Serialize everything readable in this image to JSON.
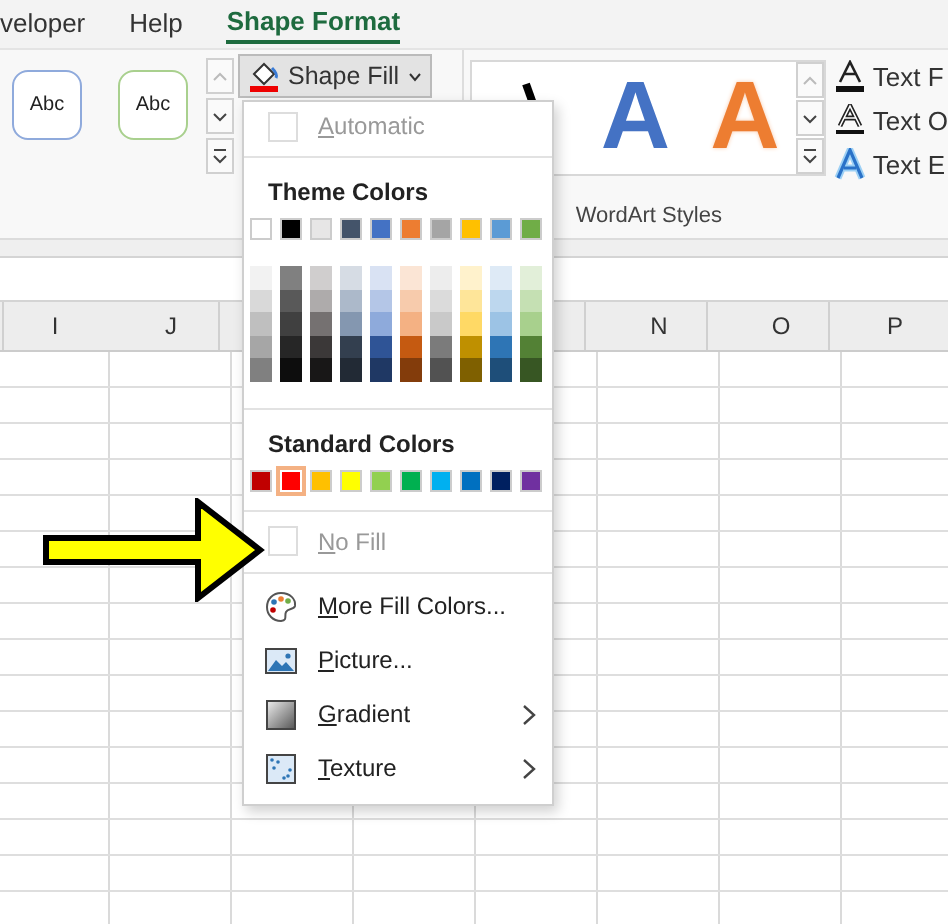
{
  "tabs": [
    {
      "label": "veloper",
      "selected": false
    },
    {
      "label": "Help",
      "selected": false
    },
    {
      "label": "Shape Format",
      "selected": true
    }
  ],
  "shape_styles": [
    {
      "label": "Abc",
      "color": "#8faadc"
    },
    {
      "label": "Abc",
      "color": "#a9d08e"
    }
  ],
  "shape_fill_button": {
    "label": "Shape Fill"
  },
  "wordart_styles": {
    "group_label": "WordArt Styles",
    "items": [
      {
        "letter": "A",
        "color": "#4472c4",
        "kind": "solid"
      },
      {
        "letter": "A",
        "color": "#ed7d31",
        "kind": "outline"
      }
    ]
  },
  "text_buttons": [
    {
      "label": "Text F",
      "kind": "fill"
    },
    {
      "label": "Text O",
      "kind": "outline"
    },
    {
      "label": "Text E",
      "kind": "effects"
    }
  ],
  "grid": {
    "columns_left_of_menu": [
      "I",
      "J"
    ],
    "columns_right_of_menu": [
      "N",
      "O",
      "P"
    ]
  },
  "menu": {
    "top_item": {
      "label": "Automatic",
      "disabled": true
    },
    "theme_title": "Theme Colors",
    "theme_colors": [
      {
        "color": "#ffffff",
        "shades": [
          {
            "color": "#f2f2f2"
          },
          {
            "color": "#d9d9d9"
          },
          {
            "color": "#bfbfbf"
          },
          {
            "color": "#a6a6a6"
          },
          {
            "color": "#808080"
          }
        ]
      },
      {
        "color": "#000000",
        "shades": [
          {
            "color": "#808080"
          },
          {
            "color": "#595959"
          },
          {
            "color": "#404040"
          },
          {
            "color": "#262626"
          },
          {
            "color": "#0d0d0d"
          }
        ]
      },
      {
        "color": "#e7e6e6",
        "shades": [
          {
            "color": "#d0cece"
          },
          {
            "color": "#aeabab"
          },
          {
            "color": "#757171"
          },
          {
            "color": "#3b3838"
          },
          {
            "color": "#181717"
          }
        ]
      },
      {
        "color": "#44546a",
        "shades": [
          {
            "color": "#d6dce4"
          },
          {
            "color": "#acb9ca"
          },
          {
            "color": "#8497b0"
          },
          {
            "color": "#333f4f"
          },
          {
            "color": "#222a35"
          }
        ]
      },
      {
        "color": "#4472c4",
        "shades": [
          {
            "color": "#d9e2f3"
          },
          {
            "color": "#b4c6e7"
          },
          {
            "color": "#8eaadb"
          },
          {
            "color": "#2f5496"
          },
          {
            "color": "#1f3864"
          }
        ]
      },
      {
        "color": "#ed7d31",
        "shades": [
          {
            "color": "#fbe5d5"
          },
          {
            "color": "#f7cbac"
          },
          {
            "color": "#f4b183"
          },
          {
            "color": "#c55a11"
          },
          {
            "color": "#833c0b"
          }
        ]
      },
      {
        "color": "#a5a5a5",
        "shades": [
          {
            "color": "#ededed"
          },
          {
            "color": "#dbdbdb"
          },
          {
            "color": "#c9c9c9"
          },
          {
            "color": "#7b7b7b"
          },
          {
            "color": "#525252"
          }
        ]
      },
      {
        "color": "#ffc000",
        "shades": [
          {
            "color": "#fff2cc"
          },
          {
            "color": "#fee599"
          },
          {
            "color": "#ffd965"
          },
          {
            "color": "#bf9000"
          },
          {
            "color": "#7f6000"
          }
        ]
      },
      {
        "color": "#5b9bd5",
        "shades": [
          {
            "color": "#deeaf6"
          },
          {
            "color": "#bdd7ee"
          },
          {
            "color": "#9cc3e5"
          },
          {
            "color": "#2e75b5"
          },
          {
            "color": "#1e4e79"
          }
        ]
      },
      {
        "color": "#70ad47",
        "shades": [
          {
            "color": "#e2efd9"
          },
          {
            "color": "#c5e0b3"
          },
          {
            "color": "#a8d08d"
          },
          {
            "color": "#538135"
          },
          {
            "color": "#375623"
          }
        ]
      }
    ],
    "standard_title": "Standard Colors",
    "standard_colors": [
      {
        "color": "#c00000",
        "selected": false
      },
      {
        "color": "#ff0000",
        "selected": true
      },
      {
        "color": "#ffc000",
        "selected": false
      },
      {
        "color": "#ffff00",
        "selected": false
      },
      {
        "color": "#92d050",
        "selected": false
      },
      {
        "color": "#00b050",
        "selected": false
      },
      {
        "color": "#00b0f0",
        "selected": false
      },
      {
        "color": "#0070c0",
        "selected": false
      },
      {
        "color": "#002060",
        "selected": false
      },
      {
        "color": "#7030a0",
        "selected": false
      }
    ],
    "no_fill": {
      "label": "No Fill",
      "disabled": true
    },
    "items": [
      {
        "label": "More Fill Colors...",
        "kind": "palette",
        "submenu": false
      },
      {
        "label": "Picture...",
        "kind": "image",
        "submenu": false
      },
      {
        "label": "Gradient",
        "kind": "gradient",
        "submenu": true
      },
      {
        "label": "Texture",
        "kind": "texture",
        "submenu": true
      }
    ]
  }
}
